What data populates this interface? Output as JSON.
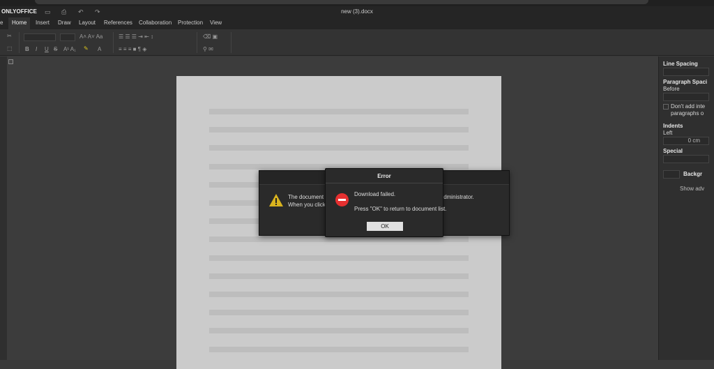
{
  "app": {
    "brand": "ONLYOFFICE",
    "document_title": "new (3).docx"
  },
  "tabs": [
    {
      "label": "e"
    },
    {
      "label": "Home",
      "active": true
    },
    {
      "label": "Insert"
    },
    {
      "label": "Draw"
    },
    {
      "label": "Layout"
    },
    {
      "label": "References"
    },
    {
      "label": "Collaboration"
    },
    {
      "label": "Protection"
    },
    {
      "label": "View"
    }
  ],
  "right_panel": {
    "line_spacing": "Line Spacing",
    "paragraph_spacing": "Paragraph Spaci",
    "before": "Before",
    "dont_add_1": "Don't add inte",
    "dont_add_2": "paragraphs o",
    "indents": "Indents",
    "left": "Left",
    "left_value": "0 cm",
    "special": "Special",
    "background": "Backgr",
    "show_advanced": "Show adv"
  },
  "warning_dialog": {
    "line1": "The document co                                                  contact your administrator.",
    "line2": "When you click th                                                   ocument."
  },
  "error_dialog": {
    "title": "Error",
    "message": "Download failed.",
    "instruction": "Press \"OK\" to return to document list.",
    "ok_label": "OK"
  },
  "colors": {
    "error_red": "#e53030",
    "warning_yellow": "#d9b31e"
  }
}
